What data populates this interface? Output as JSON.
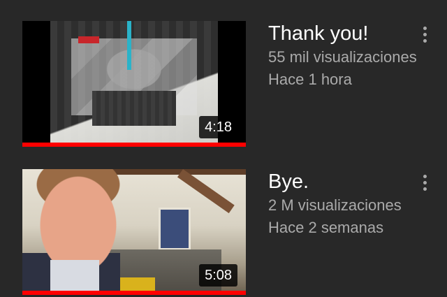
{
  "videos": [
    {
      "title": "Thank you!",
      "views": "55 mil visualizaciones",
      "age": "Hace 1 hora",
      "duration": "4:18",
      "watched_fraction": 1.0
    },
    {
      "title": "Bye.",
      "views": "2 M visualizaciones",
      "age": "Hace 2 semanas",
      "duration": "5:08",
      "watched_fraction": 1.0
    }
  ],
  "colors": {
    "background": "#282828",
    "progress": "#ff0000",
    "title_text": "#ffffff",
    "secondary_text": "#aaaaaa"
  },
  "icons": {
    "menu": "more-vert-icon"
  }
}
